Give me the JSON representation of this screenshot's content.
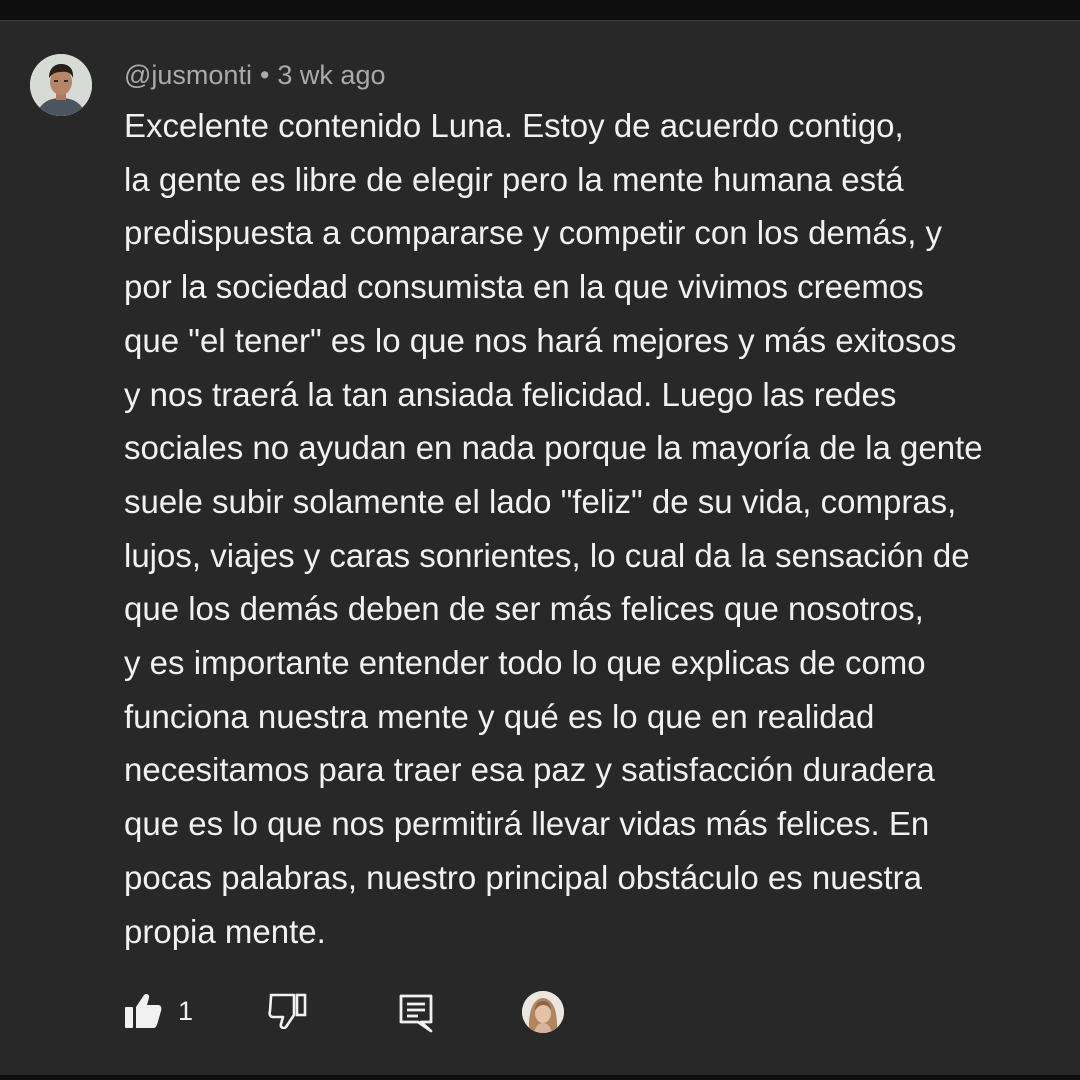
{
  "comment": {
    "author": "@jusmonti",
    "separator": "•",
    "timestamp": "3 wk ago",
    "text": "Excelente contenido Luna. Estoy de acuerdo contigo,\nla gente es libre de elegir pero la mente humana está\npredispuesta a compararse y competir con los demás, y\npor la sociedad consumista en la que vivimos creemos\nque \"el tener\" es lo que nos hará mejores y más exitosos\ny nos traerá la tan ansiada felicidad. Luego las redes\nsociales no ayudan en nada porque la mayoría de la gente\nsuele subir solamente el lado \"feliz\" de su vida, compras,\nlujos, viajes y caras sonrientes, lo cual da la sensación de\nque los demás deben de ser más felices que nosotros,\ny es importante entender todo lo que explicas de como\nfunciona nuestra mente y qué es lo que en realidad\nnecesitamos para traer esa paz y satisfacción duradera\nque es lo que nos permitirá llevar vidas más felices. En\npocas palabras, nuestro principal obstáculo es nuestra\npropia mente."
  },
  "actions": {
    "like_count": "1",
    "like_icon": "thumbs-up-filled-icon",
    "dislike_icon": "thumbs-down-outline-icon",
    "reply_icon": "reply-comment-icon"
  },
  "colors": {
    "background": "#282828",
    "text": "#f1f1f1",
    "meta": "#aaaaaa"
  }
}
